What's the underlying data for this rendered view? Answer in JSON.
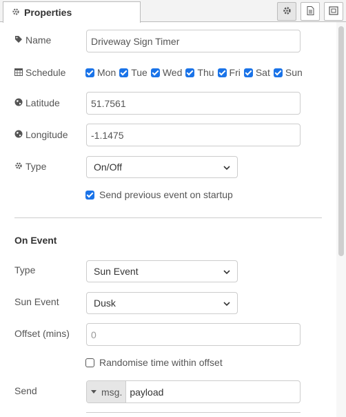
{
  "header": {
    "tab_label": "Properties",
    "buttons": [
      {
        "icon": "gear-icon",
        "active": true
      },
      {
        "icon": "document-icon",
        "active": false
      },
      {
        "icon": "appearance-icon",
        "active": false
      }
    ]
  },
  "form": {
    "name": {
      "label": "Name",
      "value": "Driveway Sign Timer"
    },
    "schedule": {
      "label": "Schedule",
      "days": [
        {
          "label": "Mon",
          "checked": true
        },
        {
          "label": "Tue",
          "checked": true
        },
        {
          "label": "Wed",
          "checked": true
        },
        {
          "label": "Thu",
          "checked": true
        },
        {
          "label": "Fri",
          "checked": true
        },
        {
          "label": "Sat",
          "checked": true
        },
        {
          "label": "Sun",
          "checked": true
        }
      ]
    },
    "latitude": {
      "label": "Latitude",
      "value": "51.7561"
    },
    "longitude": {
      "label": "Longitude",
      "value": "-1.1475"
    },
    "type": {
      "label": "Type",
      "value": "On/Off"
    },
    "send_previous": {
      "label": "Send previous event on startup",
      "checked": true
    }
  },
  "on_event": {
    "heading": "On Event",
    "type": {
      "label": "Type",
      "value": "Sun Event"
    },
    "sun_event": {
      "label": "Sun Event",
      "value": "Dusk"
    },
    "offset": {
      "label": "Offset (mins)",
      "placeholder": "0"
    },
    "randomise": {
      "label": "Randomise time within offset",
      "checked": false
    },
    "send": {
      "label": "Send",
      "prefix": "msg.",
      "value": "payload"
    }
  },
  "colors": {
    "checkbox_accent": "#1a73e8",
    "border": "#cccccc"
  }
}
